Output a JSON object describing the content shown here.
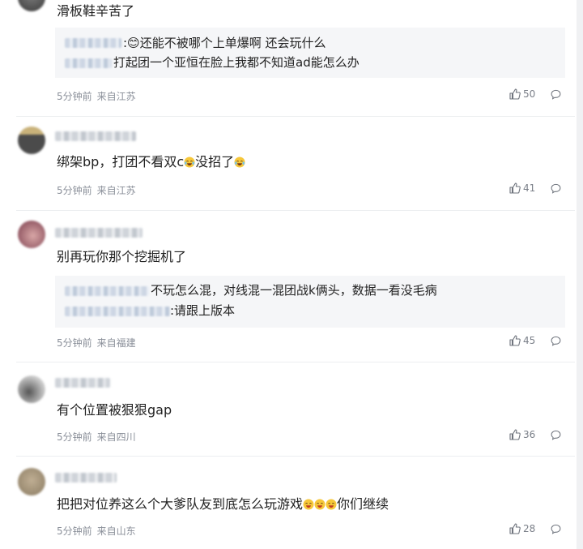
{
  "comments": [
    {
      "text": "滑板鞋辛苦了",
      "replies": [
        {
          "text": ":😊还能不被哪个上单爆啊 还会玩什么"
        },
        {
          "text": "打起团一个亚恒在脸上我都不知道ad能怎么办"
        }
      ],
      "time": "5分钟前",
      "location": "来自江苏",
      "likes": "50"
    },
    {
      "text_before": "绑架bp，打团不看双c",
      "text_after": "没招了",
      "time": "5分钟前",
      "location": "来自江苏",
      "likes": "41"
    },
    {
      "text": "别再玩你那个挖掘机了",
      "replies": [
        {
          "text": "不玩怎么混，对线混一混团战k俩头，数据一看没毛病"
        },
        {
          "text": ":请跟上版本"
        }
      ],
      "time": "5分钟前",
      "location": "来自福建",
      "likes": "45"
    },
    {
      "text": "有个位置被狠狠gap",
      "time": "5分钟前",
      "location": "来自四川",
      "likes": "36"
    },
    {
      "text_before": "把把对位养这么个大爹队友到底怎么玩游戏",
      "text_after": "你们继续",
      "time": "5分钟前",
      "location": "来自山东",
      "likes": "28"
    }
  ],
  "icons": {
    "like": "thumbs-up-icon",
    "reply": "speech-bubble-icon",
    "emoji": "laughing-tears-emoji"
  },
  "colors": {
    "meta_text": "#8a8f99",
    "reply_bg": "#f5f6f8",
    "divider": "#eceef0"
  }
}
